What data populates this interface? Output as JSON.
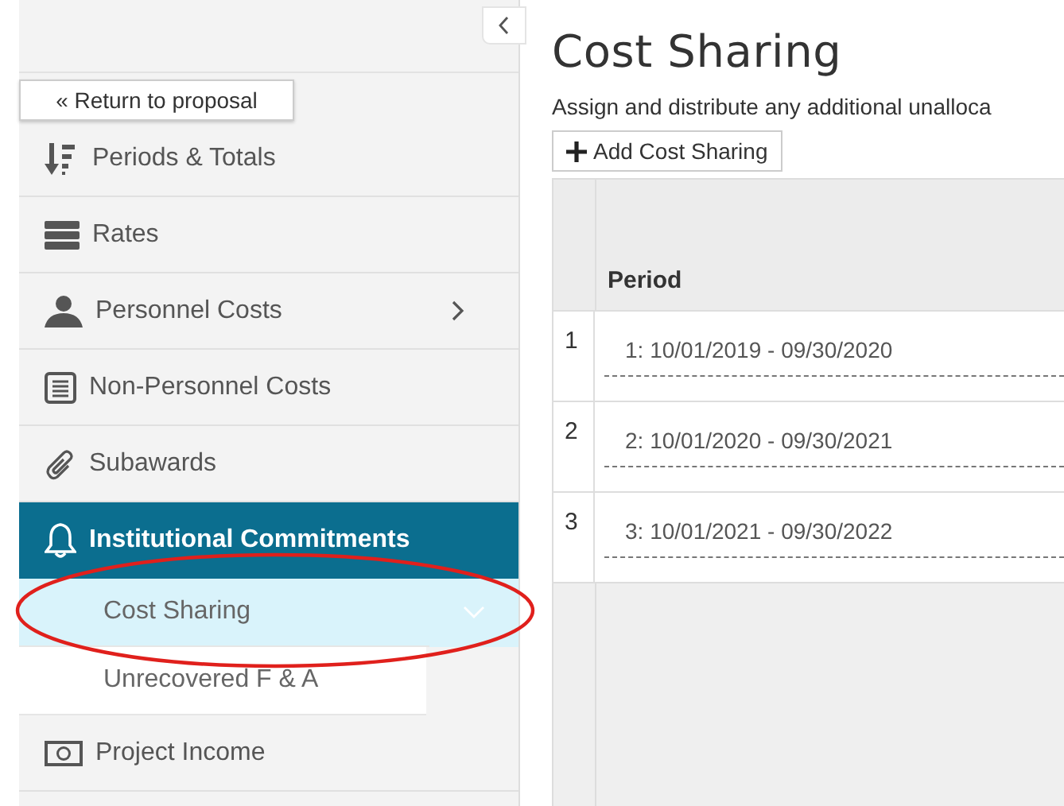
{
  "sidebar": {
    "return_link": "« Return to proposal",
    "items": [
      {
        "label": "Periods & Totals",
        "selected": false,
        "expandable": false
      },
      {
        "label": "Rates",
        "selected": false,
        "expandable": false
      },
      {
        "label": "Personnel Costs",
        "selected": false,
        "expandable": true
      },
      {
        "label": "Non-Personnel Costs",
        "selected": false,
        "expandable": false
      },
      {
        "label": "Subawards",
        "selected": false,
        "expandable": false
      },
      {
        "label": "Institutional Commitments",
        "selected": true,
        "expandable": false,
        "children": [
          {
            "label": "Cost Sharing",
            "selected": true
          },
          {
            "label": "Unrecovered F & A",
            "selected": false
          }
        ]
      },
      {
        "label": "Project Income",
        "selected": false,
        "expandable": false
      }
    ]
  },
  "main": {
    "title": "Cost Sharing",
    "description": "Assign and distribute any additional unalloca",
    "add_button": "Add Cost Sharing",
    "table": {
      "columns": [
        "Period"
      ],
      "rows": [
        {
          "number": "1",
          "period": "1: 10/01/2019 - 09/30/2020"
        },
        {
          "number": "2",
          "period": "2: 10/01/2020 - 09/30/2021"
        },
        {
          "number": "3",
          "period": "3: 10/01/2021 - 09/30/2022"
        }
      ]
    }
  }
}
